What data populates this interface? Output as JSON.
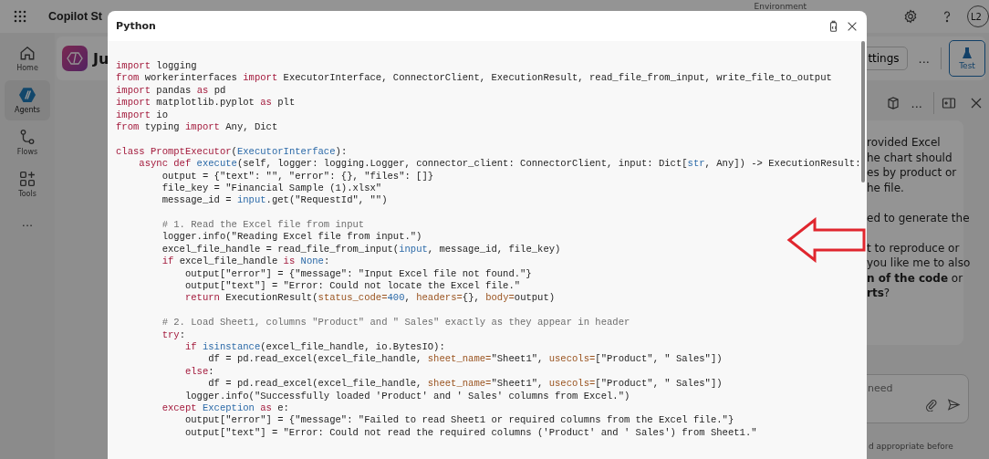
{
  "top_bar": {
    "title": "Copilot St",
    "environment_label": "Environment",
    "avatar": "L2"
  },
  "nav_rail": {
    "items": [
      {
        "kind": "home",
        "label": "Home",
        "selected": false
      },
      {
        "kind": "agents",
        "label": "Agents",
        "selected": true
      },
      {
        "kind": "flows",
        "label": "Flows",
        "selected": false
      },
      {
        "kind": "tools",
        "label": "Tools",
        "selected": false
      }
    ],
    "more": "..."
  },
  "agent_header": {
    "name": "Ju",
    "settings_button": "ttings",
    "more": "...",
    "test_button": {
      "label": "Test",
      "selected": true
    }
  },
  "test_panel": {
    "more": "...",
    "message_paragraphs": [
      [
        "rovided Excel",
        "he chart should",
        "es by product or",
        "he file."
      ],
      [
        "ed to generate the"
      ],
      [
        "t to reproduce or",
        "you like me to also",
        "**n of the code** or",
        "**rts**?"
      ]
    ],
    "input_placeholder": "need",
    "disclaimer": "d appropriate before"
  },
  "code_dialog": {
    "title": "Python",
    "lines": [
      {
        "kind": "code",
        "segments": [
          {
            "kind": "keyword",
            "text": "import"
          },
          {
            "kind": "plain",
            "text": " logging"
          }
        ]
      },
      {
        "kind": "code",
        "segments": [
          {
            "kind": "keyword",
            "text": "from"
          },
          {
            "kind": "plain",
            "text": " workerinterfaces "
          },
          {
            "kind": "keyword",
            "text": "import"
          },
          {
            "kind": "plain",
            "text": " ExecutorInterface, ConnectorClient, ExecutionResult, read_file_from_input, write_file_to_output"
          }
        ]
      },
      {
        "kind": "code",
        "segments": [
          {
            "kind": "keyword",
            "text": "import"
          },
          {
            "kind": "plain",
            "text": " pandas "
          },
          {
            "kind": "keyword",
            "text": "as"
          },
          {
            "kind": "plain",
            "text": " pd"
          }
        ]
      },
      {
        "kind": "code",
        "segments": [
          {
            "kind": "keyword",
            "text": "import"
          },
          {
            "kind": "plain",
            "text": " matplotlib.pyplot "
          },
          {
            "kind": "keyword",
            "text": "as"
          },
          {
            "kind": "plain",
            "text": " plt"
          }
        ]
      },
      {
        "kind": "code",
        "segments": [
          {
            "kind": "keyword",
            "text": "import"
          },
          {
            "kind": "plain",
            "text": " io"
          }
        ]
      },
      {
        "kind": "code",
        "segments": [
          {
            "kind": "keyword",
            "text": "from"
          },
          {
            "kind": "plain",
            "text": " typing "
          },
          {
            "kind": "keyword",
            "text": "import"
          },
          {
            "kind": "plain",
            "text": " Any, Dict"
          }
        ]
      },
      {
        "kind": "blank"
      },
      {
        "kind": "code",
        "segments": [
          {
            "kind": "keyword",
            "text": "class PromptExecutor"
          },
          {
            "kind": "plain",
            "text": "("
          },
          {
            "kind": "name",
            "text": "ExecutorInterface"
          },
          {
            "kind": "plain",
            "text": "):"
          }
        ]
      },
      {
        "kind": "code",
        "segments": [
          {
            "kind": "keyword",
            "text": "    async def"
          },
          {
            "kind": "name",
            "text": " execute"
          },
          {
            "kind": "plain",
            "text": "(self, logger: logging.Logger, connector_client: ConnectorClient, input: Dict["
          },
          {
            "kind": "name",
            "text": "str"
          },
          {
            "kind": "plain",
            "text": ", Any]) -> ExecutionResult:"
          }
        ]
      },
      {
        "kind": "code",
        "segments": [
          {
            "kind": "plain",
            "text": "        output = {\"text\": \"\", \"error\": {}, \"files\": []}"
          }
        ]
      },
      {
        "kind": "code",
        "segments": [
          {
            "kind": "plain",
            "text": "        file_key = \"Financial Sample (1).xlsx\""
          }
        ]
      },
      {
        "kind": "code",
        "segments": [
          {
            "kind": "plain",
            "text": "        message_id = "
          },
          {
            "kind": "name",
            "text": "input"
          },
          {
            "kind": "plain",
            "text": ".get(\"RequestId\", \"\")"
          }
        ]
      },
      {
        "kind": "blank"
      },
      {
        "kind": "code",
        "segments": [
          {
            "kind": "comment",
            "text": "        # 1. Read the Excel file from input"
          }
        ]
      },
      {
        "kind": "code",
        "segments": [
          {
            "kind": "plain",
            "text": "        logger.info(\"Reading Excel file from input.\")"
          }
        ]
      },
      {
        "kind": "code",
        "segments": [
          {
            "kind": "plain",
            "text": "        excel_file_handle = read_file_from_input("
          },
          {
            "kind": "name",
            "text": "input"
          },
          {
            "kind": "plain",
            "text": ", message_id, file_key)"
          }
        ]
      },
      {
        "kind": "code",
        "segments": [
          {
            "kind": "keyword",
            "text": "        if"
          },
          {
            "kind": "plain",
            "text": " excel_file_handle "
          },
          {
            "kind": "keyword",
            "text": "is"
          },
          {
            "kind": "name",
            "text": " None"
          },
          {
            "kind": "plain",
            "text": ":"
          }
        ]
      },
      {
        "kind": "code",
        "segments": [
          {
            "kind": "plain",
            "text": "            output[\"error\"] = {\"message\": \"Input Excel file not found.\"}"
          }
        ]
      },
      {
        "kind": "code",
        "segments": [
          {
            "kind": "plain",
            "text": "            output[\"text\"] = \"Error: Could not locate the Excel file.\""
          }
        ]
      },
      {
        "kind": "code",
        "segments": [
          {
            "kind": "keyword",
            "text": "            return"
          },
          {
            "kind": "plain",
            "text": " ExecutionResult("
          },
          {
            "kind": "param",
            "text": "status_code="
          },
          {
            "kind": "name",
            "text": "400"
          },
          {
            "kind": "plain",
            "text": ", "
          },
          {
            "kind": "param",
            "text": "headers="
          },
          {
            "kind": "plain",
            "text": "{}, "
          },
          {
            "kind": "param",
            "text": "body="
          },
          {
            "kind": "plain",
            "text": "output)"
          }
        ]
      },
      {
        "kind": "blank"
      },
      {
        "kind": "code",
        "segments": [
          {
            "kind": "comment",
            "text": "        # 2. Load Sheet1, columns \"Product\" and \" Sales\" exactly as they appear in header"
          }
        ]
      },
      {
        "kind": "code",
        "segments": [
          {
            "kind": "keyword",
            "text": "        try"
          },
          {
            "kind": "plain",
            "text": ":"
          }
        ]
      },
      {
        "kind": "code",
        "segments": [
          {
            "kind": "keyword",
            "text": "            if"
          },
          {
            "kind": "name",
            "text": " isinstance"
          },
          {
            "kind": "plain",
            "text": "(excel_file_handle, io.BytesIO):"
          }
        ]
      },
      {
        "kind": "code",
        "segments": [
          {
            "kind": "plain",
            "text": "                df = pd.read_excel(excel_file_handle, "
          },
          {
            "kind": "param",
            "text": "sheet_name="
          },
          {
            "kind": "plain",
            "text": "\"Sheet1\", "
          },
          {
            "kind": "param",
            "text": "usecols="
          },
          {
            "kind": "plain",
            "text": "[\"Product\", \" Sales\"])"
          }
        ]
      },
      {
        "kind": "code",
        "segments": [
          {
            "kind": "keyword",
            "text": "            else"
          },
          {
            "kind": "plain",
            "text": ":"
          }
        ]
      },
      {
        "kind": "code",
        "segments": [
          {
            "kind": "plain",
            "text": "                df = pd.read_excel(excel_file_handle, "
          },
          {
            "kind": "param",
            "text": "sheet_name="
          },
          {
            "kind": "plain",
            "text": "\"Sheet1\", "
          },
          {
            "kind": "param",
            "text": "usecols="
          },
          {
            "kind": "plain",
            "text": "[\"Product\", \" Sales\"])"
          }
        ]
      },
      {
        "kind": "code",
        "segments": [
          {
            "kind": "plain",
            "text": "            logger.info(\"Successfully loaded 'Product' and ' Sales' columns from Excel.\")"
          }
        ]
      },
      {
        "kind": "code",
        "segments": [
          {
            "kind": "keyword",
            "text": "        except"
          },
          {
            "kind": "name",
            "text": " Exception "
          },
          {
            "kind": "keyword",
            "text": "as"
          },
          {
            "kind": "plain",
            "text": " e:"
          }
        ]
      },
      {
        "kind": "code",
        "segments": [
          {
            "kind": "plain",
            "text": "            output[\"error\"] = {\"message\": \"Failed to read Sheet1 or required columns from the Excel file.\"}"
          }
        ]
      },
      {
        "kind": "code",
        "segments": [
          {
            "kind": "plain",
            "text": "            output[\"text\"] = \"Error: Could not read the required columns ('Product' and ' Sales') from Sheet1.\""
          }
        ]
      }
    ]
  }
}
